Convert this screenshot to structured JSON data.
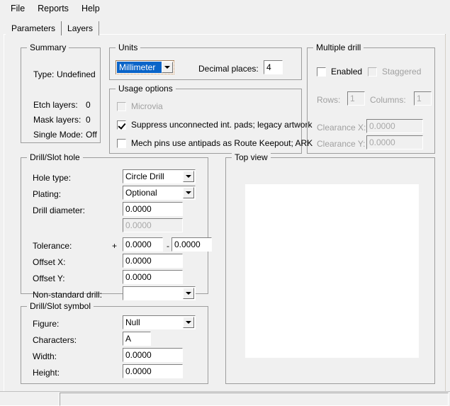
{
  "menubar": {
    "items": [
      {
        "label": "File"
      },
      {
        "label": "Reports"
      },
      {
        "label": "Help"
      }
    ]
  },
  "tabs": [
    {
      "label": "Parameters",
      "selected": true
    },
    {
      "label": "Layers",
      "selected": false
    }
  ],
  "summary": {
    "title": "Summary",
    "type_label": "Type:",
    "type_value": "Undefined",
    "etch_label": "Etch layers:",
    "etch_value": "0",
    "mask_label": "Mask layers:",
    "mask_value": "0",
    "single_mode_label": "Single Mode:",
    "single_mode_value": "Off"
  },
  "units": {
    "title": "Units",
    "unit_value": "Millimeter",
    "decimal_label": "Decimal places:",
    "decimal_value": "4"
  },
  "usage_options": {
    "title": "Usage options",
    "microvia_label": "Microvia",
    "suppress_label": "Suppress unconnected int. pads; legacy artwork",
    "mech_pins_label": "Mech pins use antipads as Route Keepout; ARK"
  },
  "multiple_drill": {
    "title": "Multiple drill",
    "enabled_label": "Enabled",
    "staggered_label": "Staggered",
    "rows_label": "Rows:",
    "rows_value": "1",
    "columns_label": "Columns:",
    "columns_value": "1",
    "clearance_x_label": "Clearance X:",
    "clearance_x_value": "0.0000",
    "clearance_y_label": "Clearance Y:",
    "clearance_y_value": "0.0000"
  },
  "drill_slot_hole": {
    "title": "Drill/Slot hole",
    "hole_type_label": "Hole type:",
    "hole_type_value": "Circle Drill",
    "plating_label": "Plating:",
    "plating_value": "Optional",
    "drill_diameter_label": "Drill diameter:",
    "drill_diameter_value": "0.0000",
    "drill_diameter2_value": "0.0000",
    "tolerance_label": "Tolerance:",
    "tolerance_plus_sign": "+",
    "tolerance_plus_value": "0.0000",
    "tolerance_minus_sign": "-",
    "tolerance_minus_value": "0.0000",
    "offset_x_label": "Offset X:",
    "offset_x_value": "0.0000",
    "offset_y_label": "Offset Y:",
    "offset_y_value": "0.0000",
    "non_standard_label": "Non-standard drill:",
    "non_standard_value": ""
  },
  "drill_slot_symbol": {
    "title": "Drill/Slot symbol",
    "figure_label": "Figure:",
    "figure_value": "Null",
    "characters_label": "Characters:",
    "characters_value": "A",
    "width_label": "Width:",
    "width_value": "0.0000",
    "height_label": "Height:",
    "height_value": "0.0000"
  },
  "top_view": {
    "title": "Top view",
    "canvas_color": "#ffffff"
  },
  "statusbar": {
    "left_text": "",
    "right_text": ""
  },
  "theme": {
    "window_bg": "#f0f0f0",
    "field_bg": "#ffffff",
    "border": "#9d9d9d",
    "selection_blue": "#0a64c8",
    "disabled_text": "#a0a0a0"
  }
}
